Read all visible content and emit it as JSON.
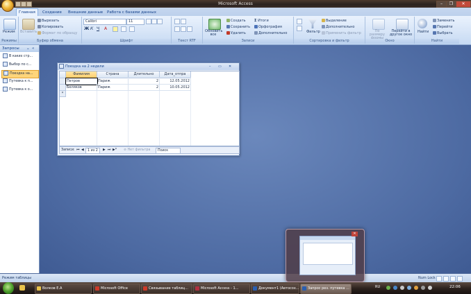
{
  "app": {
    "title": "Microsoft Access"
  },
  "ribbon": {
    "tabs": [
      "Главная",
      "Создание",
      "Внешние данные",
      "Работа с базами данных"
    ],
    "groups": {
      "views": {
        "label": "Режимы",
        "button": "Режим"
      },
      "clipboard": {
        "label": "Буфер обмена",
        "paste": "Вставить",
        "cut": "Вырезать",
        "copy": "Копировать",
        "format_painter": "Формат по образцу"
      },
      "font": {
        "label": "Шрифт",
        "font_name": "Calibri",
        "font_size": "11"
      },
      "rich_text": {
        "label": "Текст RTF"
      },
      "records": {
        "label": "Записи",
        "refresh": "Обновить все",
        "new": "Создать",
        "save": "Сохранить",
        "delete": "Удалить",
        "totals": "Итоги",
        "spelling": "Орфография",
        "more": "Дополнительно"
      },
      "sort_filter": {
        "label": "Сортировка и фильтр",
        "filter": "Фильтр",
        "selection": "Выделение",
        "advanced": "Дополнительно",
        "toggle_filter": "Применить фильтр"
      },
      "window": {
        "label": "Окно",
        "size_to_fit": "По размеру формы",
        "switch_windows": "Перейти в другое окно"
      },
      "find": {
        "label": "Найти",
        "find": "Найти",
        "replace": "Заменить",
        "goto": "Перейти",
        "select": "Выбрать"
      }
    }
  },
  "nav_pane": {
    "header": "Запросы",
    "items": [
      "В каких стр...",
      "Выбор по с...",
      "Поездка на...",
      "Путевка к п...",
      "Путевка к о..."
    ],
    "selected_index": 2
  },
  "query_window": {
    "title": "Поездка на 2 недели",
    "columns": [
      "Фамилия",
      "Страна",
      "Длительно",
      "Дата_отпра"
    ],
    "rows": [
      [
        "Петров",
        "Париж",
        "2",
        "12.05.2012"
      ],
      [
        "Беляков",
        "Париж",
        "2",
        "10.05.2012"
      ]
    ],
    "new_row_marker": "*",
    "record_nav": {
      "label": "Записи:",
      "position": "1 из 2",
      "filter": "Нет фильтра",
      "search": "Поиск"
    }
  },
  "status_bar": {
    "left": "Режим таблицы",
    "right": "Num Lock"
  },
  "taskbar": {
    "tasks": [
      {
        "label": "Волков Е.А",
        "color": "#e8c24a"
      },
      {
        "label": "Microsoft Office",
        "color": "#cc3a2a"
      },
      {
        "label": "Связывание таблиц...",
        "color": "#cc3a2a"
      },
      {
        "label": "Microsoft Access - 1...",
        "color": "#b03040"
      },
      {
        "label": "Документ1 (Автосох...",
        "color": "#2b5fb0"
      },
      {
        "label": "Запрос рез. путевка ...",
        "color": "#2b5fb0"
      }
    ],
    "active_index": 5,
    "lang": "RU",
    "clock": "22:06"
  }
}
